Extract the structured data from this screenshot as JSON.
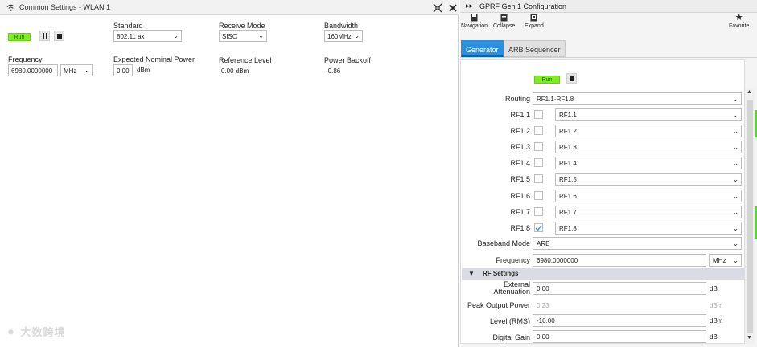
{
  "left_panel": {
    "title": "Common Settings - WLAN 1",
    "run_label": "Run",
    "standard": {
      "label": "Standard",
      "value": "802.11 ax"
    },
    "receive_mode": {
      "label": "Receive Mode",
      "value": "SISO"
    },
    "bandwidth": {
      "label": "Bandwidth",
      "value": "160MHz"
    },
    "frequency": {
      "label": "Frequency",
      "value": "6980.0000000",
      "unit": "MHz"
    },
    "expected_nominal_power": {
      "label": "Expected Nominal Power",
      "value": "0.00",
      "unit": "dBm"
    },
    "reference_level": {
      "label": "Reference Level",
      "value": "0.00 dBm"
    },
    "power_backoff": {
      "label": "Power Backoff",
      "value": "-0.86"
    },
    "watermark": "大数跨境"
  },
  "right_panel": {
    "title": "GPRF Gen 1 Configuration",
    "toolbar": {
      "navigation": "Navigation",
      "collapse": "Collapse",
      "expand": "Expand",
      "favorite": "Favorite"
    },
    "tabs": [
      "Generator",
      "ARB Sequencer"
    ],
    "run_label": "Run",
    "routing": {
      "label": "Routing",
      "value": "RF1.1-RF1.8"
    },
    "rf_rows": [
      {
        "label": "RF1.1",
        "value": "RF1.1",
        "checked": false
      },
      {
        "label": "RF1.2",
        "value": "RF1.2",
        "checked": false
      },
      {
        "label": "RF1.3",
        "value": "RF1.3",
        "checked": false
      },
      {
        "label": "RF1.4",
        "value": "RF1.4",
        "checked": false
      },
      {
        "label": "RF1.5",
        "value": "RF1.5",
        "checked": false
      },
      {
        "label": "RF1.6",
        "value": "RF1.6",
        "checked": false
      },
      {
        "label": "RF1.7",
        "value": "RF1.7",
        "checked": false
      },
      {
        "label": "RF1.8",
        "value": "RF1.8",
        "checked": true
      }
    ],
    "baseband_mode": {
      "label": "Baseband Mode",
      "value": "ARB"
    },
    "frequency": {
      "label": "Frequency",
      "value": "6980.0000000",
      "unit": "MHz"
    },
    "rf_settings_header": "RF Settings",
    "external_attenuation": {
      "label_line1": "External",
      "label_line2": "Attenuation",
      "value": "0.00",
      "unit": "dB"
    },
    "peak_output_power": {
      "label": "Peak Output Power",
      "value": "0.23",
      "unit": "dBm"
    },
    "level_rms": {
      "label": "Level (RMS)",
      "value": "-10.00",
      "unit": "dBm"
    },
    "digital_gain": {
      "label": "Digital Gain",
      "value": "0.00",
      "unit": "dB"
    }
  },
  "colors": {
    "run_green": "#7fec24",
    "tab_active": "#2b8fe0",
    "status_green": "#66cc44"
  }
}
